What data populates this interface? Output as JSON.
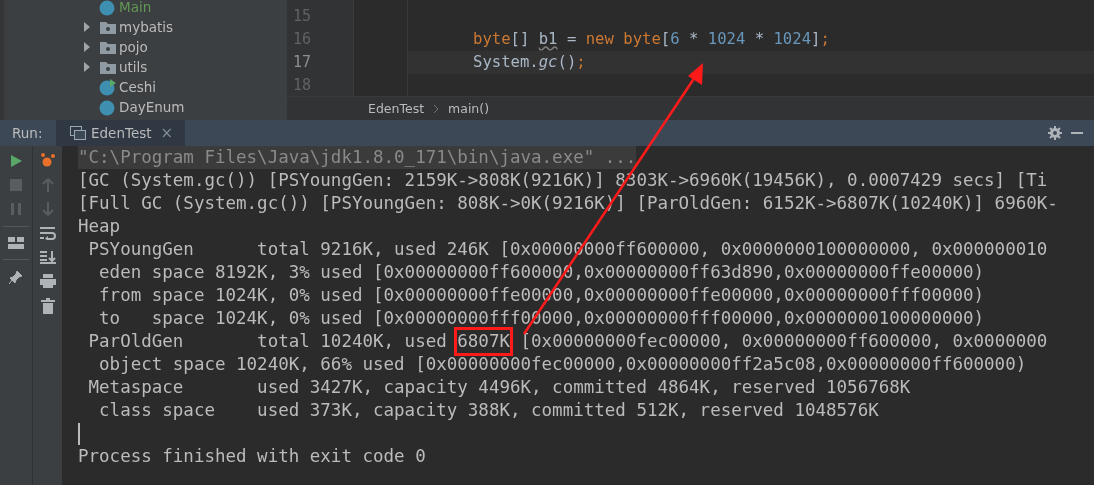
{
  "project_tree": {
    "items": [
      {
        "kind": "class",
        "label": "Main",
        "selected": true,
        "runnable": false
      },
      {
        "kind": "folder",
        "label": "mybatis",
        "expanded": false
      },
      {
        "kind": "folder",
        "label": "pojo",
        "expanded": false
      },
      {
        "kind": "folder",
        "label": "utils",
        "expanded": false
      },
      {
        "kind": "class",
        "label": "Ceshi",
        "selected": false,
        "runnable": true
      },
      {
        "kind": "enum",
        "label": "DayEnum",
        "selected": false,
        "runnable": false
      }
    ]
  },
  "editor": {
    "lines": [
      {
        "number": "15",
        "current": false
      },
      {
        "number": "16",
        "current": false,
        "tokens": [
          {
            "kind": "keyword",
            "text": "byte"
          },
          {
            "kind": "plain",
            "text": "[] "
          },
          {
            "kind": "unused",
            "text": "b1"
          },
          {
            "kind": "plain",
            "text": " = "
          },
          {
            "kind": "keyword",
            "text": "new byte"
          },
          {
            "kind": "plain",
            "text": "["
          },
          {
            "kind": "number",
            "text": "6"
          },
          {
            "kind": "plain",
            "text": " * "
          },
          {
            "kind": "number",
            "text": "1024"
          },
          {
            "kind": "plain",
            "text": " * "
          },
          {
            "kind": "number",
            "text": "1024"
          },
          {
            "kind": "plain",
            "text": "]"
          },
          {
            "kind": "keyword",
            "text": ";"
          }
        ]
      },
      {
        "number": "17",
        "current": true,
        "tokens": [
          {
            "kind": "plain",
            "text": "System."
          },
          {
            "kind": "italic",
            "text": "gc"
          },
          {
            "kind": "plain",
            "text": "()"
          },
          {
            "kind": "keyword",
            "text": ";"
          }
        ]
      },
      {
        "number": "18",
        "current": false
      }
    ],
    "breadcrumb": [
      "EdenTest",
      "main()"
    ]
  },
  "run_panel": {
    "label": "Run:",
    "tab": {
      "title": "EdenTest",
      "close": "×",
      "selected": true
    }
  },
  "console": {
    "lines": [
      {
        "kind": "folded",
        "text": "\"C:\\Program Files\\Java\\jdk1.8.0_171\\bin\\java.exe\" ..."
      },
      {
        "kind": "output",
        "text": "[GC (System.gc()) [PSYoungGen: 2159K->808K(9216K)] 8303K->6960K(19456K), 0.0007429 secs] [Ti"
      },
      {
        "kind": "output",
        "text": "[Full GC (System.gc()) [PSYoungGen: 808K->0K(9216K)] [ParOldGen: 6152K->6807K(10240K)] 6960K-"
      },
      {
        "kind": "output",
        "text": "Heap"
      },
      {
        "kind": "output",
        "text": " PSYoungGen      total 9216K, used 246K [0x00000000ff600000, 0x0000000100000000, 0x000000010"
      },
      {
        "kind": "output",
        "text": "  eden space 8192K, 3% used [0x00000000ff600000,0x00000000ff63d890,0x00000000ffe00000)"
      },
      {
        "kind": "output",
        "text": "  from space 1024K, 0% used [0x00000000ffe00000,0x00000000ffe00000,0x00000000fff00000)"
      },
      {
        "kind": "output",
        "text": "  to   space 1024K, 0% used [0x00000000fff00000,0x00000000fff00000,0x0000000100000000)"
      },
      {
        "kind": "output",
        "parts": [
          {
            "text": " ParOldGen       total 10240K, used ",
            "boxed": false
          },
          {
            "text": "6807K",
            "boxed": true
          },
          {
            "text": " [0x00000000fec00000, 0x00000000ff600000, 0x0000000",
            "boxed": false
          }
        ]
      },
      {
        "kind": "output",
        "text": "  object space 10240K, 66% used [0x00000000fec00000,0x00000000ff2a5c08,0x00000000ff600000)"
      },
      {
        "kind": "output",
        "text": " Metaspace       used 3427K, capacity 4496K, committed 4864K, reserved 1056768K"
      },
      {
        "kind": "output",
        "text": "  class space    used 373K, capacity 388K, committed 512K, reserved 1048576K"
      },
      {
        "kind": "cursor"
      },
      {
        "kind": "output",
        "text": "Process finished with exit code 0"
      }
    ]
  },
  "callout": {
    "kind": "arrow"
  }
}
